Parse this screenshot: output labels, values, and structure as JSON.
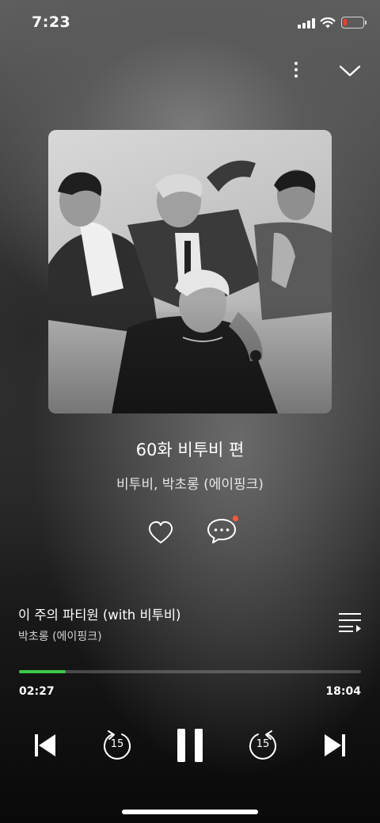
{
  "status_bar": {
    "time": "7:23",
    "battery_level": 0.1,
    "battery_color": "#ff3b30"
  },
  "top_controls": {
    "more_icon": "more-vertical-icon",
    "close_icon": "chevron-down-icon"
  },
  "episode": {
    "title": "60화 비투비 편",
    "artist": "비투비, 박초롱 (에이핑크)",
    "like_icon": "heart-outline-icon",
    "comment_icon": "chat-bubble-icon",
    "comment_badge_color": "#ff5a3c"
  },
  "now_playing": {
    "title": "이 주의 파티원 (with 비투비)",
    "artist": "박초롱 (에이핑크)",
    "playlist_icon": "playlist-icon"
  },
  "progress": {
    "elapsed": "02:27",
    "total": "18:04",
    "fraction": 0.1356,
    "accent_color": "#3ac94a"
  },
  "transport": {
    "rewind_seconds": "15",
    "forward_seconds": "15",
    "state": "playing"
  }
}
